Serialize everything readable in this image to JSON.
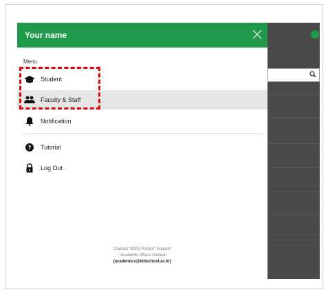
{
  "drawer": {
    "title": "Your name",
    "menu_label": "Menu",
    "items": [
      {
        "label": "Student",
        "icon": "graduation-cap-icon"
      },
      {
        "label": "Faculty & Staff",
        "icon": "users-icon"
      },
      {
        "label": "Notification",
        "icon": "bell-icon"
      },
      {
        "label": "Tutorial",
        "icon": "question-circle-icon"
      },
      {
        "label": "Log Out",
        "icon": "lock-icon"
      }
    ],
    "footer": {
      "line1": "Contact \"KDIS Pocket\" Support",
      "line2": ": Academic Affairs Division",
      "email": "(academics@kdischool.ac.kr)"
    }
  },
  "colors": {
    "header_green": "#1f9a4a",
    "overlay_dark": "#4a4a4a",
    "highlight_red": "#e10000",
    "active_row": "#e6e6e6"
  }
}
